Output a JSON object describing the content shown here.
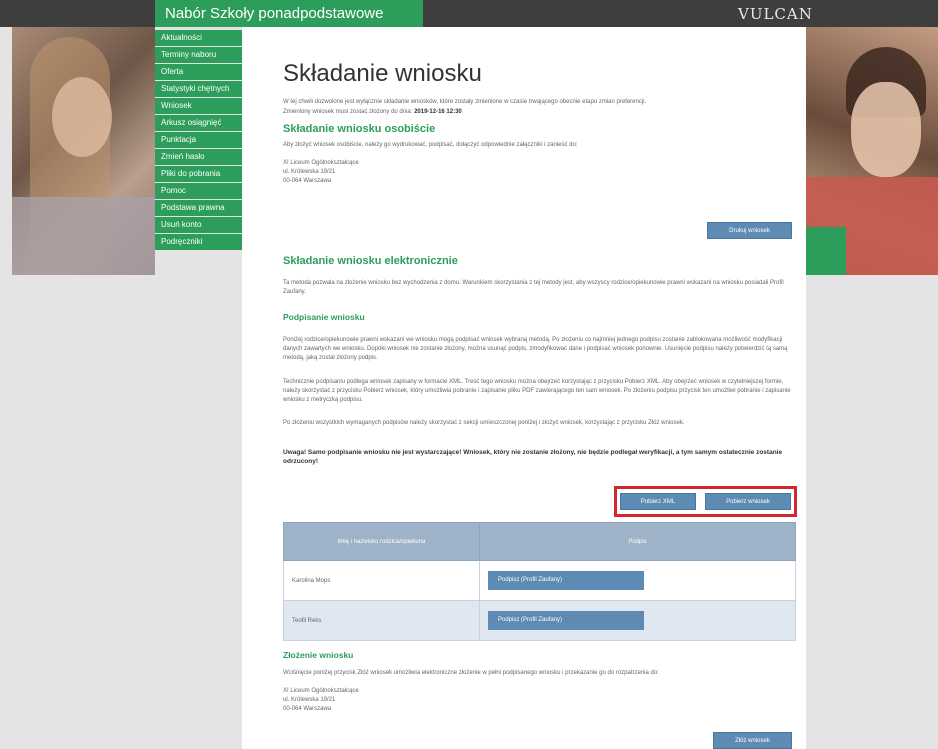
{
  "header": {
    "title": "Nabór Szkoły ponadpodstawowe",
    "logo": "VULCAN"
  },
  "sidebar": {
    "items": [
      {
        "label": "Aktualności"
      },
      {
        "label": "Terminy naboru"
      },
      {
        "label": "Oferta"
      },
      {
        "label": "Statystyki chętnych"
      },
      {
        "label": "Wniosek"
      },
      {
        "label": "Arkusz osiągnięć"
      },
      {
        "label": "Punktacja"
      },
      {
        "label": "Zmień hasło"
      },
      {
        "label": "Pliki do pobrania"
      },
      {
        "label": "Pomoc"
      },
      {
        "label": "Podstawa prawna"
      },
      {
        "label": "Usuń konto"
      },
      {
        "label": "Podręczniki"
      }
    ]
  },
  "main": {
    "page_title": "Składanie wniosku",
    "intro_line1": "W tej chwili dozwolone jest wyłącznie składanie wniosków, które zostały zmienione w czasie trwającego obecnie etapu zmian preferencji.",
    "intro_line2_prefix": "Zmieniony wniosek musi zostać złożony do dnia: ",
    "intro_deadline": "2019-12-16 12:30",
    "personal": {
      "heading": "Składanie wniosku osobiście",
      "text": "Aby złożyć wniosek osobiście, należy go wydrukować, podpisać, dołączyć odpowiednie załączniki i zanieść do:",
      "address_line1": "XI Liceum Ogólnokształcące",
      "address_line2": "ul. Królewska 19/21",
      "address_line3": "00-064 Warszawa",
      "print_button": "Drukuj wniosek"
    },
    "electronic": {
      "heading": "Składanie wniosku elektronicznie",
      "text": "Ta metoda pozwala na złożenie wniosku bez wychodzenia z domu. Warunkiem skorzystania z tej metody jest, aby wszyscy rodzice/opiekunowie prawni wskazani na wniosku posiadali Profil Zaufany."
    },
    "signing": {
      "heading": "Podpisanie wniosku",
      "para1": "Poniżej rodzice/opiekunowie prawni wskazani we wniosku mogą podpisać wniosek wybraną metodą. Po złożeniu co najmniej jednego podpisu zostanie zablokowana możliwość modyfikacji danych zawartych we wniosku. Dopóki wniosek nie zostanie złożony, można usunąć podpis, zmodyfikować dane i podpisać wniosek ponownie. Usunięcie podpisu należy potwierdzić tą samą metodą, jaką został złożony podpis.",
      "para2": "Technicznie podpisaniu podlega wniosek zapisany w formacie XML. Treść tego wniosku można obejrzeć korzystając z przycisku Pobierz XML. Aby obejrzeć wniosek w czytelniejszej formie, należy skorzystać z przycisku Pobierz wniosek, który umożliwia pobranie i zapisanie pliku PDF zawierającego ten sam wniosek. Po złożeniu podpisu przycisk ten umożliwi pobranie i zapisanie wniosku z metryczką podpisu.",
      "para3": "Po złożeniu wszystkich wymaganych podpisów należy skorzystać z sekcji umieszczonej poniżej i złożyć wniosek, korzystając z przycisku Złóż wniosek.",
      "warning": "Uwaga! Samo podpisanie wniosku nie jest wystarczające! Wniosek, który nie zostanie złożony, nie będzie podlegał weryfikacji, a tym samym ostatecznie zostanie odrzucony!",
      "download_xml_button": "Pobierz XML",
      "download_pdf_button": "Pobierz wniosek"
    },
    "signatures_table": {
      "columns": [
        "Imię i nazwisko rodzica/opiekuna",
        "Podpis"
      ],
      "rows": [
        {
          "name": "Karolina Mops",
          "action": "Podpisz (Profil Zaufany)"
        },
        {
          "name": "Teofil Reks",
          "action": "Podpisz (Profil Zaufany)"
        }
      ]
    },
    "submit": {
      "heading": "Złożenie wniosku",
      "text": "Wciśnięcie poniżej przycisk Złóż wniosek umożliwia elektroniczne złożenie w pełni podpisanego wniosku i przekazanie go do rozpatrzenia do:",
      "address_line1": "XI Liceum Ogólnokształcące",
      "address_line2": "ul. Królewska 19/21",
      "address_line3": "00-064 Warszawa",
      "submit_button": "Złóż wniosek"
    }
  },
  "colors": {
    "brand_green": "#2c9d5a",
    "button_blue": "#5d8bb4",
    "highlight_red": "#d3262e",
    "topbar": "#3e3e3e"
  }
}
